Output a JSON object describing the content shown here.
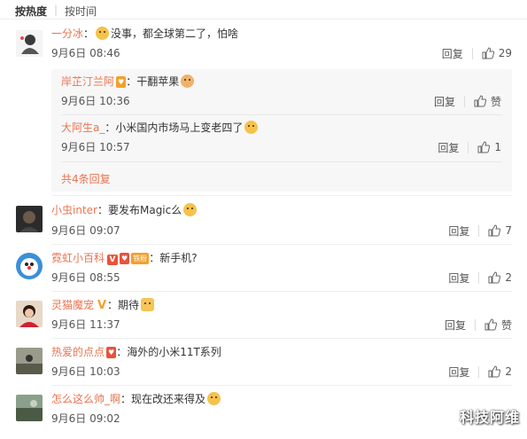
{
  "sort_bar": {
    "hot_label": "按热度",
    "time_label": "按时间"
  },
  "comments": [
    {
      "user": "一分冰",
      "text": "没事，都全球第二了，怕啥",
      "time": "9月6日 08:46",
      "reply": "回复",
      "likes": "29"
    },
    {
      "user": "小虫inter",
      "sep": "：",
      "text": "要发布Magic么",
      "time": "9月6日 09:07",
      "reply": "回复",
      "likes": "7"
    },
    {
      "user": "霓虹小百科",
      "badge": "铁粉",
      "sep": "：",
      "text": "新手机?",
      "time": "9月6日 08:55",
      "reply": "回复",
      "likes": "2"
    },
    {
      "user": "灵猫魔宠",
      "sep": "：",
      "text": "期待",
      "time": "9月6日 11:37",
      "reply": "回复",
      "likes": "赞"
    },
    {
      "user": "热爱的点点",
      "sep": "：",
      "text": "海外的小米11T系列",
      "time": "9月6日 10:03",
      "reply": "回复",
      "likes": "2"
    },
    {
      "user": "怎么这么帅_啊",
      "sep": "：",
      "text": "现在改还来得及",
      "time": "9月6日 09:02",
      "reply": "回复",
      "likes": ""
    }
  ],
  "replies": [
    {
      "user": "岸芷汀兰阿",
      "sep": "：",
      "text": "干翻苹果",
      "time": "9月6日 10:36",
      "reply": "回复",
      "likes": "赞"
    },
    {
      "user": "大阿生a_",
      "sep": "：",
      "text": "小米国内市场马上变老四了",
      "time": "9月6日 10:57",
      "reply": "回复",
      "likes": "1"
    }
  ],
  "more_replies": "共4条回复",
  "watermark": "科技阿维",
  "colors": {
    "username": "#eb7350",
    "text": "#333333",
    "meta": "#555555"
  }
}
